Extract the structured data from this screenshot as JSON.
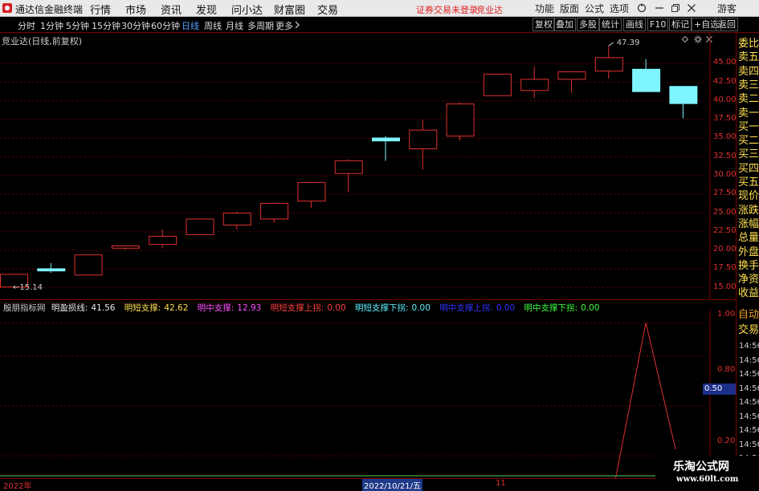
{
  "menubar": {
    "app_title": "通达信金融终端",
    "items": [
      "行情",
      "市场",
      "资讯",
      "发现",
      "问小达",
      "财富圈",
      "交易"
    ],
    "alert": "证券交易未登录",
    "alert_stock": "竞业达",
    "right_items": [
      "功能",
      "版面",
      "公式",
      "选项"
    ],
    "user": "游客"
  },
  "toolbar": {
    "periods": [
      "分时",
      "1分钟",
      "5分钟",
      "15分钟",
      "30分钟",
      "60分钟",
      "日线",
      "周线",
      "月线",
      "多周期",
      "更多"
    ],
    "active_period": "日线",
    "right_buttons": [
      "复权",
      "叠加",
      "多股",
      "统计",
      "画线",
      "F10",
      "标记",
      "+自选",
      "返回"
    ]
  },
  "chart": {
    "name": "竞业达(日线,前复权)",
    "high_label": "47.39",
    "low_label": "15.14",
    "up_color": "#e03030",
    "down_color": "#7ff5ff",
    "y_ticks": [
      "45.00",
      "42.50",
      "40.00",
      "37.50",
      "35.00",
      "32.50",
      "30.00",
      "27.50",
      "25.00",
      "22.50",
      "20.00",
      "17.50",
      "15.00"
    ]
  },
  "chart_data": {
    "type": "candlestick",
    "ylim": [
      14.0,
      47.5
    ],
    "candles": [
      {
        "o": 15.1,
        "c": 16.8,
        "h": 16.8,
        "l": 15.1
      },
      {
        "o": 17.6,
        "c": 17.2,
        "h": 18.3,
        "l": 17.0
      },
      {
        "o": 16.7,
        "c": 19.4,
        "h": 19.4,
        "l": 16.7
      },
      {
        "o": 20.3,
        "c": 20.6,
        "h": 20.7,
        "l": 20.1
      },
      {
        "o": 20.8,
        "c": 21.9,
        "h": 22.8,
        "l": 20.3
      },
      {
        "o": 22.1,
        "c": 24.2,
        "h": 24.3,
        "l": 22.1
      },
      {
        "o": 23.4,
        "c": 25.0,
        "h": 25.2,
        "l": 22.8
      },
      {
        "o": 24.2,
        "c": 26.3,
        "h": 26.4,
        "l": 23.7
      },
      {
        "o": 26.6,
        "c": 29.1,
        "h": 29.2,
        "l": 25.7
      },
      {
        "o": 30.3,
        "c": 32.0,
        "h": 32.2,
        "l": 27.8
      },
      {
        "o": 35.1,
        "c": 34.6,
        "h": 35.3,
        "l": 32.0
      },
      {
        "o": 33.6,
        "c": 36.1,
        "h": 37.5,
        "l": 30.8
      },
      {
        "o": 35.3,
        "c": 39.6,
        "h": 39.8,
        "l": 34.7
      },
      {
        "o": 40.7,
        "c": 43.6,
        "h": 43.6,
        "l": 40.7
      },
      {
        "o": 41.4,
        "c": 42.9,
        "h": 44.6,
        "l": 40.4
      },
      {
        "o": 42.9,
        "c": 43.9,
        "h": 43.9,
        "l": 41.1
      },
      {
        "o": 44.0,
        "c": 45.8,
        "h": 47.39,
        "l": 43.0
      },
      {
        "o": 44.3,
        "c": 41.2,
        "h": 45.6,
        "l": 41.2
      },
      {
        "o": 42.0,
        "c": 39.6,
        "h": 42.0,
        "l": 37.7
      }
    ],
    "indicator": {
      "ylim": [
        0.1,
        1.05
      ],
      "line": [
        {
          "bar": 16.0,
          "v": 0.0
        },
        {
          "bar": 17.0,
          "v": 1.0
        },
        {
          "bar": 17.8,
          "v": 0.24
        }
      ]
    }
  },
  "indicator": {
    "name": "殷朋指标网",
    "fields": [
      {
        "label": "明盈损线:",
        "value": "41.56",
        "color": "#e8e8e8"
      },
      {
        "label": "明短支撑:",
        "value": "42.62",
        "color": "#ffe050"
      },
      {
        "label": "明中支撑:",
        "value": "12.93",
        "color": "#ff50ff"
      },
      {
        "label": "明短支撑上拐:",
        "value": "0.00",
        "color": "#ff4040"
      },
      {
        "label": "明短支撑下拐:",
        "value": "0.00",
        "color": "#5ff0ff"
      },
      {
        "label": "明中支撑上拐:",
        "value": "0.00",
        "color": "#3535ff"
      },
      {
        "label": "明中支撑下拐:",
        "value": "0.00",
        "color": "#40ff40"
      }
    ],
    "y_ticks": [
      "1.00",
      "0.80",
      "0.50",
      "0.20"
    ],
    "current_value": "0.50",
    "line_color": "#e03030"
  },
  "right_panel": {
    "quote_labels": [
      "委比",
      "卖五",
      "卖四",
      "卖三",
      "卖二",
      "卖一",
      "买一",
      "买二",
      "买三",
      "买四",
      "买五",
      "现价",
      "涨跌",
      "涨幅",
      "总量",
      "外盘",
      "换手",
      "净资",
      "收益"
    ],
    "lower_labels": [
      "自动",
      "交易"
    ],
    "times": [
      "14:56",
      "14:56",
      "14:56",
      "14:56",
      "14:56",
      "14:56",
      "14:56",
      "14:56",
      "14:56",
      "14:56"
    ]
  },
  "bottom_axis": {
    "year": "2022年",
    "date_chip": "2022/10/21/五",
    "month": "11"
  },
  "watermark": {
    "line1": "乐淘公式网",
    "line2": "www.60lt.com"
  }
}
